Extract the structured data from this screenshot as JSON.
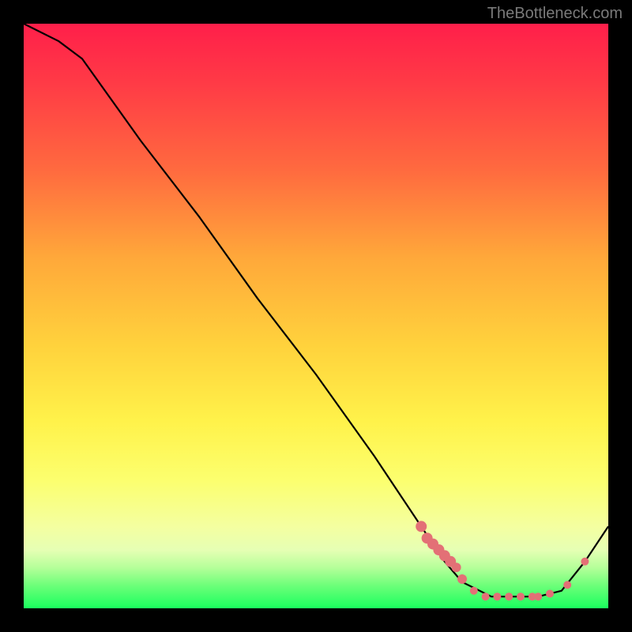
{
  "watermark": "TheBottleneck.com",
  "chart_data": {
    "type": "line",
    "title": "",
    "xlabel": "",
    "ylabel": "",
    "xlim": [
      0,
      100
    ],
    "ylim": [
      0,
      100
    ],
    "series": [
      {
        "name": "curve",
        "x": [
          0,
          6,
          10,
          20,
          30,
          40,
          50,
          60,
          68,
          72,
          75,
          80,
          85,
          88,
          92,
          96,
          100
        ],
        "values": [
          100,
          97,
          94,
          80,
          67,
          53,
          40,
          26,
          14,
          8,
          4.5,
          2,
          2,
          2,
          3,
          8,
          14
        ]
      }
    ],
    "marker_series": {
      "name": "dots",
      "x": [
        68,
        69,
        70,
        71,
        72,
        73,
        74,
        75,
        77,
        79,
        81,
        83,
        85,
        87,
        88,
        90,
        93,
        96
      ],
      "values": [
        14,
        12,
        11,
        10,
        9,
        8,
        7,
        5,
        3,
        2,
        2,
        2,
        2,
        2,
        2,
        2.5,
        4,
        8
      ],
      "color": "#e37076",
      "radius_default": 5,
      "radius_overrides": {
        "0": 7,
        "1": 7,
        "2": 7,
        "3": 7,
        "4": 7,
        "5": 7,
        "6": 6,
        "7": 6
      }
    },
    "curve_stroke": "#000000",
    "curve_width": 2.2
  }
}
